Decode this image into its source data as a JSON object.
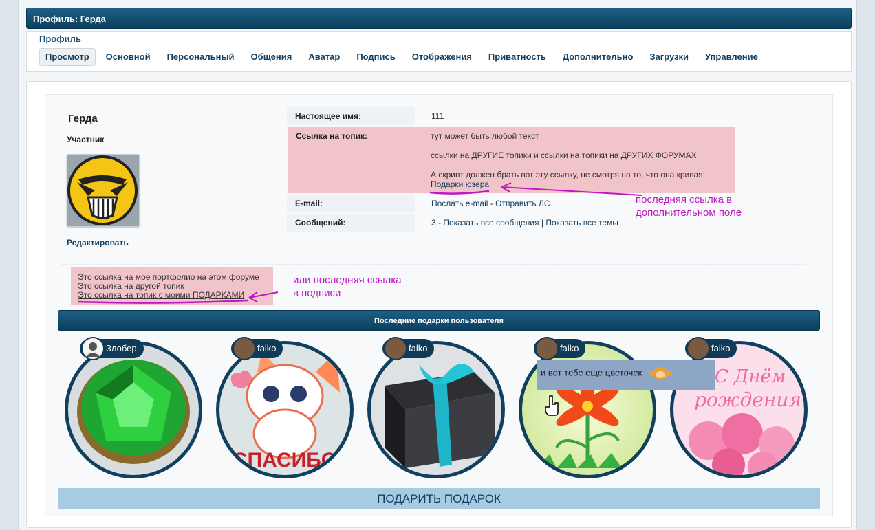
{
  "header": {
    "title": "Профиль: Герда"
  },
  "profile_nav": {
    "label": "Профиль",
    "tabs": [
      "Просмотр",
      "Основной",
      "Персональный",
      "Общения",
      "Аватар",
      "Подпись",
      "Отображения",
      "Приватность",
      "Дополнительно",
      "Загрузки",
      "Управление"
    ],
    "active_tab": "Просмотр"
  },
  "user": {
    "name": "Герда",
    "rank": "Участник",
    "edit_label": "Редактировать"
  },
  "fields": {
    "real_name_label": "Настоящее имя:",
    "real_name_value": "111",
    "topic_link_label": "Ссылка на топик:",
    "topic_lines": [
      "тут может быть любой текст",
      "ссылки на ДРУГИЕ топики и ссылки на топики на ДРУГИХ ФОРУМАХ",
      "А скрипт должен брать вот эту ссылку, не смотря на то, что она кривая:"
    ],
    "topic_last_link": "Подарки юзера",
    "email_label": "E-mail:",
    "email_send": "Послать e-mail",
    "email_sep": " - ",
    "email_pm": "Отправить ЛС",
    "posts_label": "Сообщений:",
    "posts_count": "3",
    "posts_sep1": " - ",
    "posts_all": "Показать все сообщения",
    "posts_sep2": " | ",
    "posts_topics": "Показать все темы"
  },
  "annotations": {
    "field_note_1": "последняя ссылка в",
    "field_note_2": "дополнительном поле",
    "sig_note_1": "или последняя ссылка",
    "sig_note_2": "в подписи"
  },
  "signature": {
    "lines": [
      "Это ссылка на мое портфолио на этом форуме",
      "Это ссылка на другой топик"
    ],
    "last_link": "Это ссылка на топик с моими ПОДАРКАМИ"
  },
  "gifts": {
    "header": "Последние подарки пользователя",
    "items": [
      {
        "giver": "Злобер"
      },
      {
        "giver": "faiko"
      },
      {
        "giver": "faiko"
      },
      {
        "giver": "faiko"
      },
      {
        "giver": "faiko"
      }
    ],
    "sticker_text": "СПАСИБО",
    "card_text_1": "С Днём",
    "card_text_2": "рождения!",
    "tooltip": "и вот тебе еще цветочек",
    "give_button": "ПОДАРИТЬ ПОДАРОК"
  },
  "colors": {
    "header_bg": "#0d3f5e",
    "highlight_pink": "#f0c4c9",
    "annotation": "#c018c0",
    "give_button_bg": "#a6cbe3"
  }
}
